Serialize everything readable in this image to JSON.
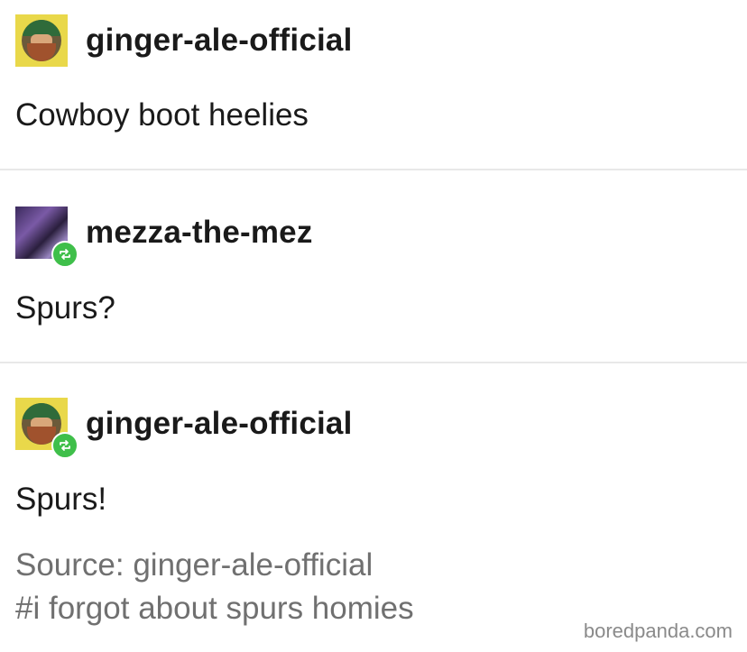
{
  "posts": [
    {
      "username": "ginger-ale-official",
      "text": "Cowboy boot heelies",
      "avatar_icon": "ginger-ale-avatar",
      "reblogged": false
    },
    {
      "username": "mezza-the-mez",
      "text": "Spurs?",
      "avatar_icon": "mezza-avatar",
      "reblogged": true
    },
    {
      "username": "ginger-ale-official",
      "text": "Spurs!",
      "avatar_icon": "ginger-ale-avatar",
      "reblogged": true
    }
  ],
  "source": {
    "line": "Source: ginger-ale-official",
    "tag": "#i forgot about spurs homies"
  },
  "watermark": "boredpanda.com",
  "colors": {
    "reblog_badge": "#3fbf4a",
    "meta_text": "#707070",
    "divider": "#e8e8e8"
  }
}
